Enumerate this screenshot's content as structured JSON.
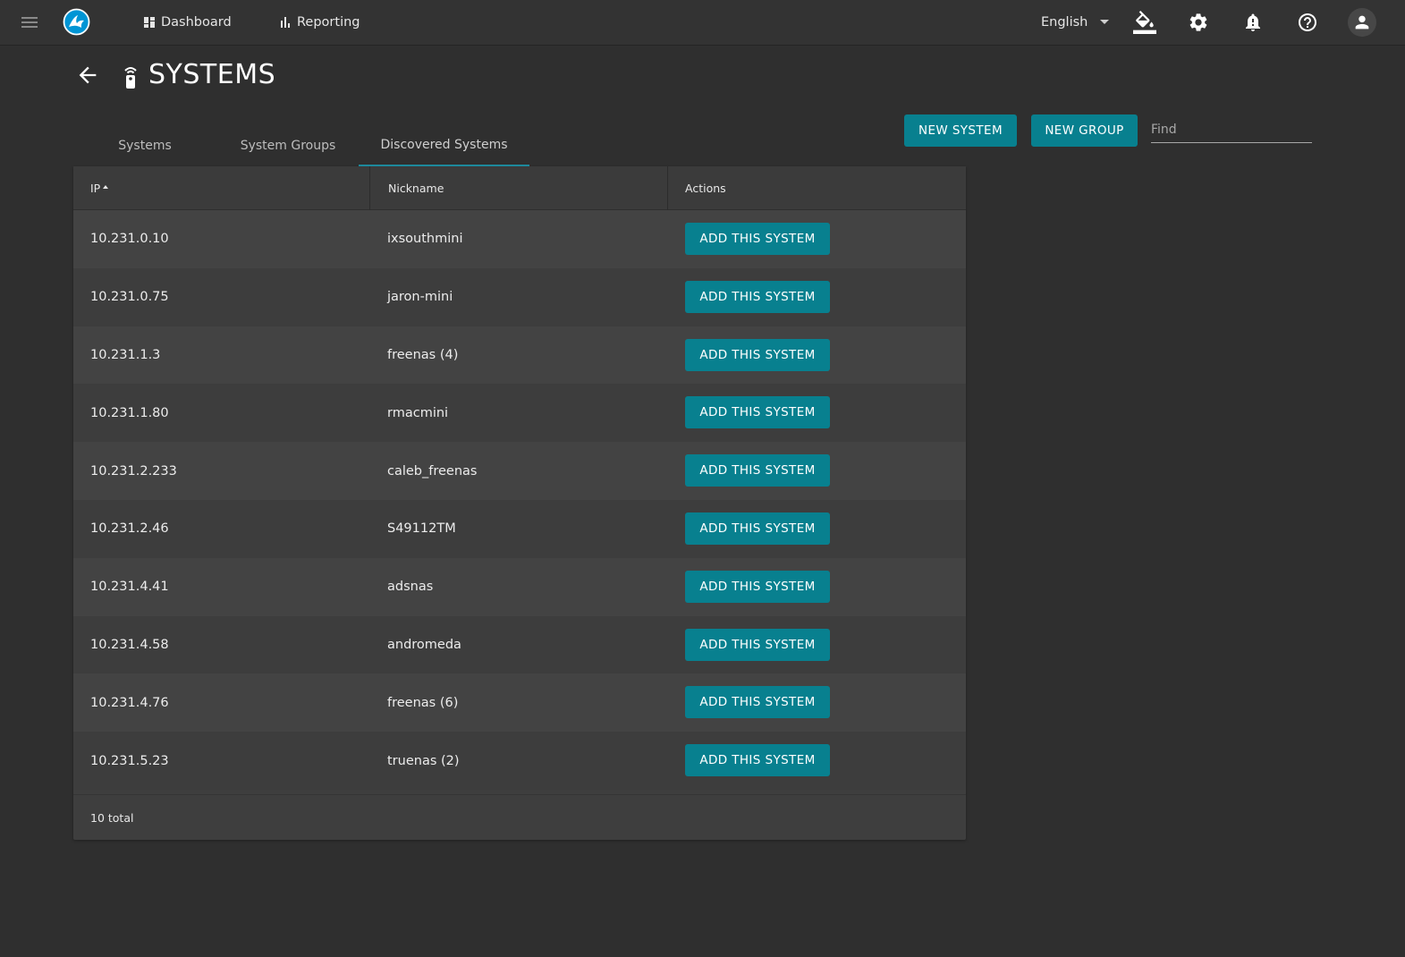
{
  "topbar": {
    "nav": [
      {
        "label": "Dashboard",
        "icon": "dashboard-icon"
      },
      {
        "label": "Reporting",
        "icon": "bar-chart-icon"
      }
    ],
    "language": "English",
    "icons": [
      "theme-paint-icon",
      "gear-icon",
      "bell-alert-icon",
      "help-icon",
      "account-icon"
    ]
  },
  "page": {
    "title": "SYSTEMS"
  },
  "tabs": [
    {
      "label": "Systems",
      "active": false
    },
    {
      "label": "System Groups",
      "active": false
    },
    {
      "label": "Discovered Systems",
      "active": true
    }
  ],
  "actions": {
    "new_system": "NEW SYSTEM",
    "new_group": "NEW GROUP",
    "find_placeholder": "Find"
  },
  "table": {
    "columns": [
      "IP",
      "Nickname",
      "Actions"
    ],
    "sort": {
      "column": "IP",
      "direction": "asc"
    },
    "action_label": "ADD THIS SYSTEM",
    "rows": [
      {
        "ip": "10.231.0.10",
        "nickname": "ixsouthmini"
      },
      {
        "ip": "10.231.0.75",
        "nickname": "jaron-mini"
      },
      {
        "ip": "10.231.1.3",
        "nickname": "freenas (4)"
      },
      {
        "ip": "10.231.1.80",
        "nickname": "rmacmini"
      },
      {
        "ip": "10.231.2.233",
        "nickname": "caleb_freenas"
      },
      {
        "ip": "10.231.2.46",
        "nickname": "S49112TM"
      },
      {
        "ip": "10.231.4.41",
        "nickname": "adsnas"
      },
      {
        "ip": "10.231.4.58",
        "nickname": "andromeda"
      },
      {
        "ip": "10.231.4.76",
        "nickname": "freenas (6)"
      },
      {
        "ip": "10.231.5.23",
        "nickname": "truenas (2)"
      }
    ],
    "footer": "10 total"
  },
  "colors": {
    "accent": "#08808f",
    "tab_indicator": "#1e8fa3",
    "background": "#2f2f2f",
    "card": "#3e3e3e",
    "logo": "#0095d5"
  }
}
